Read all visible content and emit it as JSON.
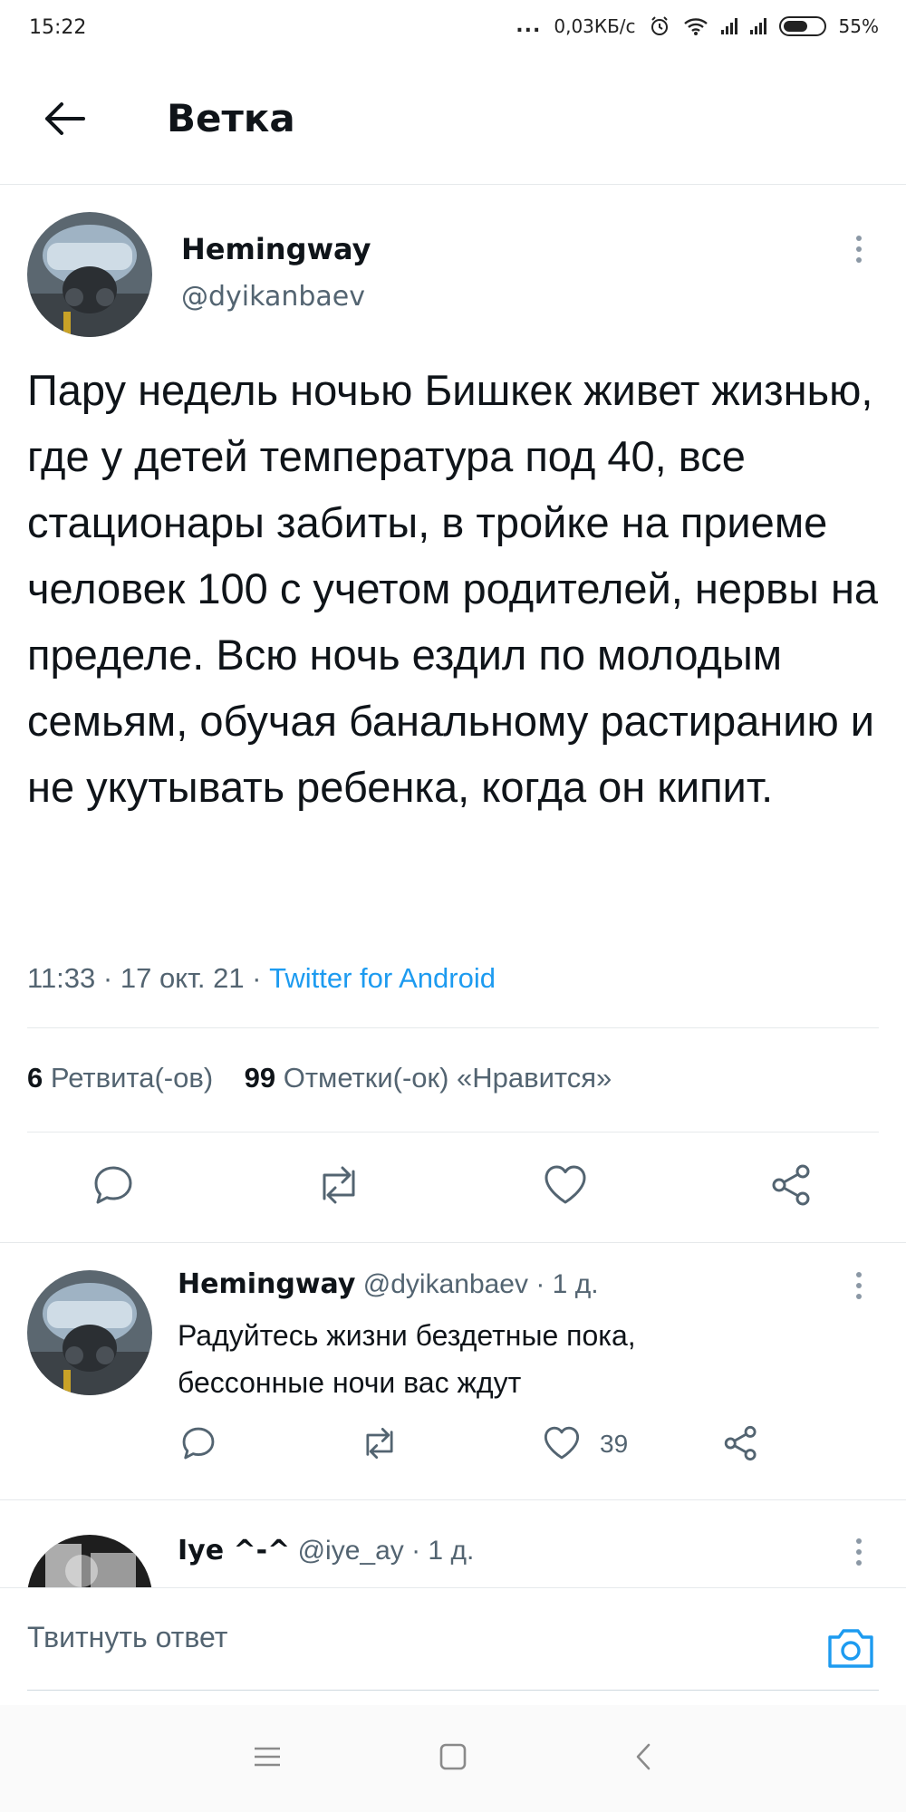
{
  "status_bar": {
    "time": "15:22",
    "dots": "...",
    "net_speed": "0,03КБ/с",
    "battery": "55%"
  },
  "header": {
    "title": "Ветка"
  },
  "tweet": {
    "author_name": "Hemingway",
    "author_handle": "@dyikanbaev",
    "text": "Пару недель ночью Бишкек живет жизнью, где у детей температура под 40, все стационары забиты, в тройке на приеме человек 100 с учетом родителей, нервы на пределе. Всю ночь ездил по молодым семьям, обучая банальному растиранию и не укутывать ребенка, когда он кипит.",
    "time": "11:33",
    "separator": " · ",
    "date": "17 окт. 21",
    "source": "Twitter for Android",
    "retweets_count": "6",
    "retweets_label": "Ретвита(-ов)",
    "likes_count": "99",
    "likes_label": "Отметки(-ок) «Нравится»"
  },
  "replies": [
    {
      "name": "Hemingway",
      "handle": "@dyikanbaev",
      "age": "· 1 д.",
      "text_line1": "Радуйтесь жизни бездетные пока,",
      "text_line2": "бессонные ночи вас ждут",
      "likes": "39"
    },
    {
      "name": "Iye ^-^",
      "handle": "@iye_ay",
      "age": "· 1 д."
    }
  ],
  "compose": {
    "placeholder": "Твитнуть ответ"
  },
  "colors": {
    "accent": "#1d9bf0",
    "text": "#0f1419",
    "secondary": "#536471",
    "icon": "#536471"
  }
}
